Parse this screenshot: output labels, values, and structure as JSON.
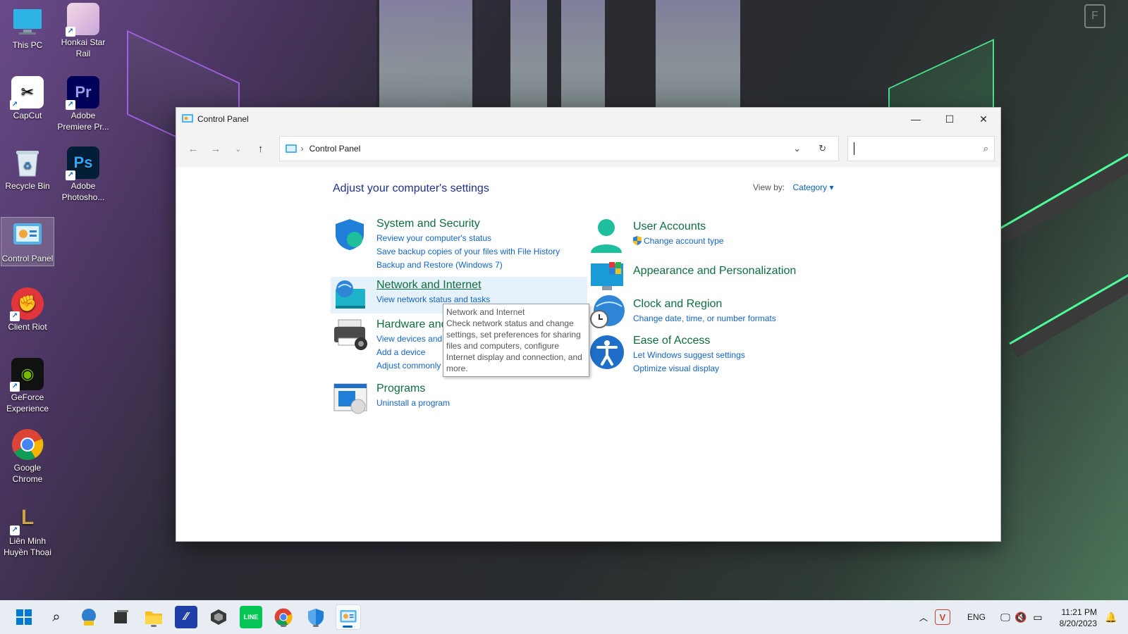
{
  "desktop": {
    "icons": [
      {
        "label": "This PC",
        "icon": "monitor-icon"
      },
      {
        "label": "Honkai Star Rail",
        "icon": "honkai-star-rail-icon"
      },
      {
        "label": "CapCut",
        "icon": "capcut-icon"
      },
      {
        "label": "Adobe Premiere Pr...",
        "icon": "premiere-icon",
        "glyph": "Pr"
      },
      {
        "label": "Recycle Bin",
        "icon": "recycle-bin-icon"
      },
      {
        "label": "Adobe Photosho...",
        "icon": "photoshop-icon",
        "glyph": "Ps"
      },
      {
        "label": "Control Panel",
        "icon": "control-panel-icon"
      },
      {
        "label": "Client Riot",
        "icon": "riot-client-icon"
      },
      {
        "label": "GeForce Experience",
        "icon": "geforce-icon"
      },
      {
        "label": "Google Chrome",
        "icon": "chrome-icon"
      },
      {
        "label": "Liên Minh Huyền Thoại",
        "icon": "league-of-legends-icon"
      }
    ]
  },
  "window": {
    "title": "Control Panel",
    "controls": {
      "minimize": "—",
      "maximize": "☐",
      "close": "✕"
    },
    "address": {
      "crumb": "Control Panel"
    },
    "search": {
      "placeholder": ""
    }
  },
  "main": {
    "heading": "Adjust your computer's settings",
    "view_by_label": "View by:",
    "view_by_value": "Category ▾",
    "categories": [
      {
        "title": "System and Security",
        "icon": "shield-icon",
        "links": [
          "Review your computer's status",
          "Save backup copies of your files with File History",
          "Backup and Restore (Windows 7)"
        ]
      },
      {
        "title": "Network and Internet",
        "icon": "network-globe-icon",
        "links": [
          "View network status and tasks"
        ]
      },
      {
        "title": "Hardware and Sound",
        "icon": "printer-icon",
        "links": [
          "View devices and printers",
          "Add a device",
          "Adjust commonly used mobility settings"
        ]
      },
      {
        "title": "Programs",
        "icon": "programs-icon",
        "links": [
          "Uninstall a program"
        ]
      },
      {
        "title": "User Accounts",
        "icon": "user-icon",
        "links": [
          "Change account type"
        ]
      },
      {
        "title": "Appearance and Personalization",
        "icon": "appearance-icon",
        "links": []
      },
      {
        "title": "Clock and Region",
        "icon": "clock-globe-icon",
        "links": [
          "Change date, time, or number formats"
        ]
      },
      {
        "title": "Ease of Access",
        "icon": "accessibility-icon",
        "links": [
          "Let Windows suggest settings",
          "Optimize visual display"
        ]
      }
    ],
    "tooltip": {
      "title": "Network and Internet",
      "body": "Check network status and change settings, set preferences for sharing files and computers, configure Internet display and connection, and more."
    }
  },
  "taskbar": {
    "apps": [
      "start-icon",
      "search-icon",
      "pal-icon",
      "task-view-icon",
      "file-explorer-icon",
      "affinity-icon",
      "unity-icon",
      "line-icon",
      "chrome-icon",
      "defender-icon",
      "control-panel-icon"
    ],
    "tray": {
      "language": "ENG",
      "time": "11:21 PM",
      "date": "8/20/2023"
    }
  }
}
